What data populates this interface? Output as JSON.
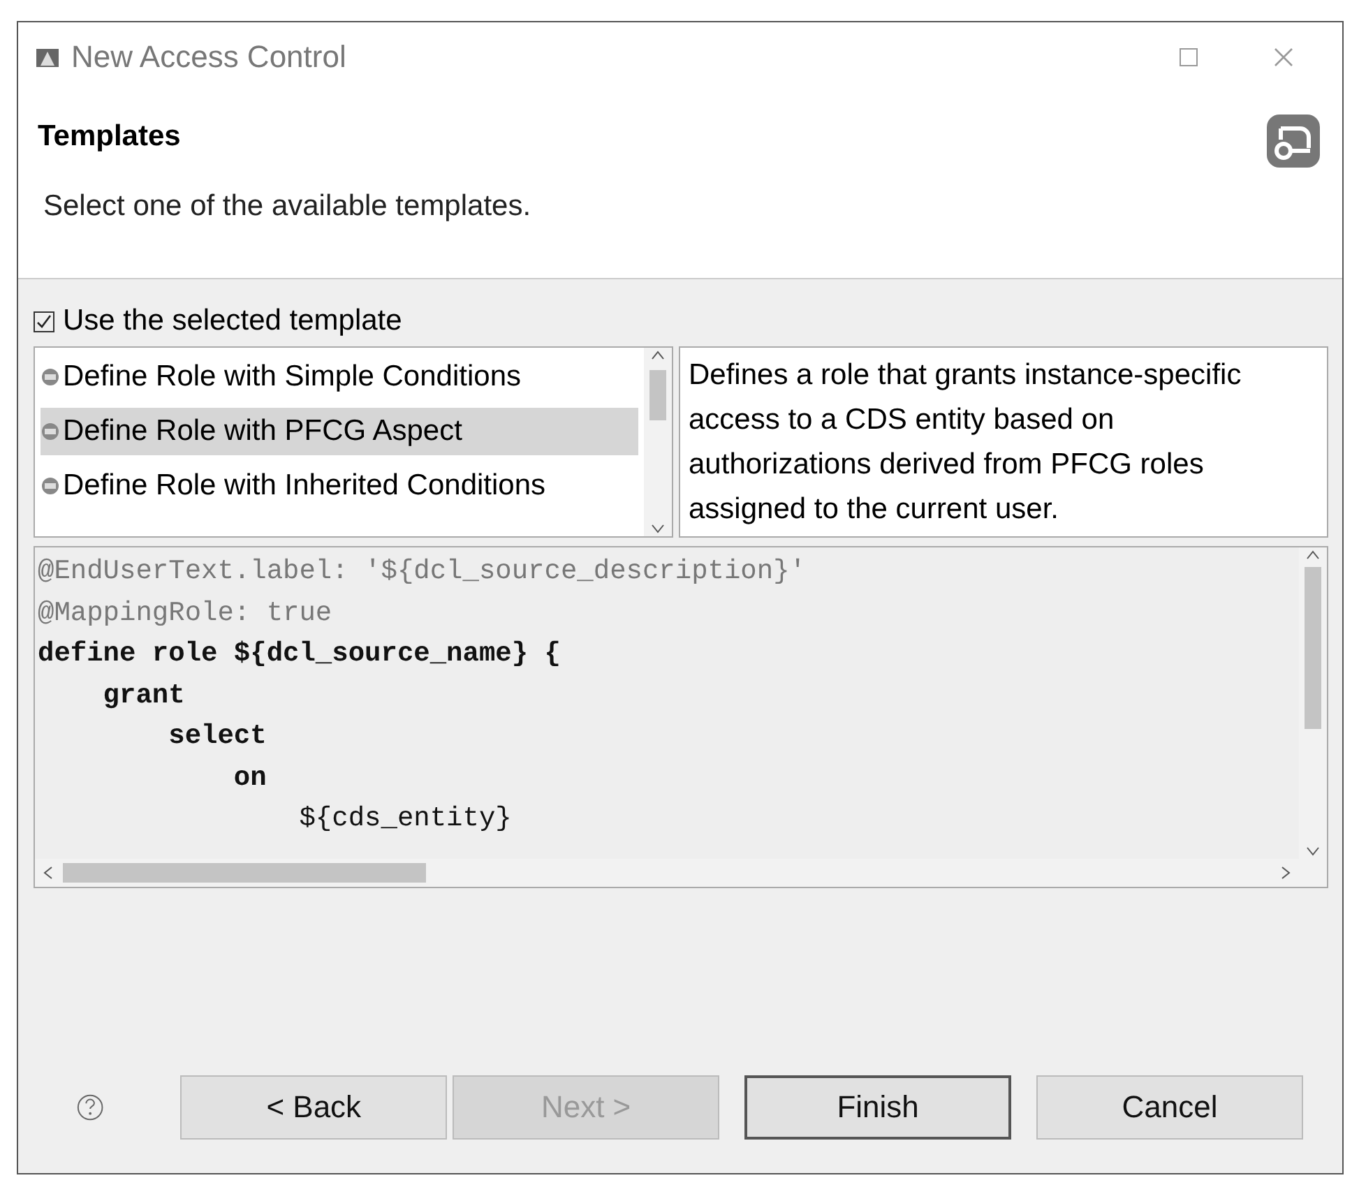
{
  "window": {
    "title": "New Access Control"
  },
  "header": {
    "title": "Templates",
    "description": "Select one of the available templates."
  },
  "use_template": {
    "label": "Use the selected template",
    "checked": true
  },
  "templates": [
    {
      "label": "Define Role with Simple Conditions",
      "selected": false
    },
    {
      "label": "Define Role with PFCG Aspect",
      "selected": true
    },
    {
      "label": "Define Role with Inherited Conditions",
      "selected": false
    }
  ],
  "template_description": "Defines a role that grants instance-specific access to a CDS entity based on authorizations derived from PFCG roles assigned to the current user.",
  "code_lines": [
    {
      "kind": "annotation",
      "text": "@EndUserText.label: '${dcl_source_description}'"
    },
    {
      "kind": "annotation",
      "text": "@MappingRole: true"
    },
    {
      "kind": "keyword",
      "text": "define role ${dcl_source_name} {"
    },
    {
      "kind": "keyword",
      "text": "    grant"
    },
    {
      "kind": "keyword",
      "text": "        select"
    },
    {
      "kind": "keyword",
      "text": "            on"
    },
    {
      "kind": "plain",
      "text": "                ${cds_entity}"
    }
  ],
  "buttons": [
    {
      "label": "< Back",
      "disabled": false,
      "default": false
    },
    {
      "label": "Next >",
      "disabled": true,
      "default": false
    },
    {
      "label": "Finish",
      "disabled": false,
      "default": true
    },
    {
      "label": "Cancel",
      "disabled": false,
      "default": false
    }
  ]
}
